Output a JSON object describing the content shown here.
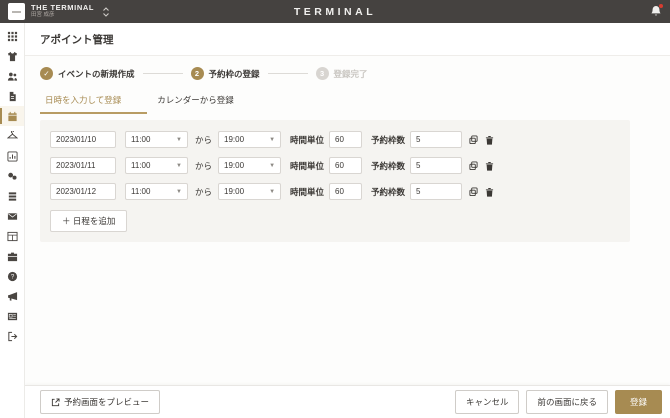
{
  "topbar": {
    "brand_title": "THE TERMINAL",
    "brand_subtitle": "田宮 成彦",
    "center_logo": "TERMINAL"
  },
  "page": {
    "title": "アポイント管理"
  },
  "stepper": {
    "steps": [
      {
        "num": "✓",
        "label": "イベントの新規作成",
        "state": "done"
      },
      {
        "num": "2",
        "label": "予約枠の登録",
        "state": "active"
      },
      {
        "num": "3",
        "label": "登録完了",
        "state": "inactive"
      }
    ]
  },
  "tabs": [
    {
      "label": "日時を入力して登録",
      "active": true
    },
    {
      "label": "カレンダーから登録",
      "active": false
    }
  ],
  "panel": {
    "rows": [
      {
        "date": "2023/01/10",
        "start": "11:00",
        "joiner": "から",
        "end": "19:00",
        "unit_label": "時間単位",
        "unit": "60",
        "slots_label": "予約枠数",
        "slots": "5"
      },
      {
        "date": "2023/01/11",
        "start": "11:00",
        "joiner": "から",
        "end": "19:00",
        "unit_label": "時間単位",
        "unit": "60",
        "slots_label": "予約枠数",
        "slots": "5"
      },
      {
        "date": "2023/01/12",
        "start": "11:00",
        "joiner": "から",
        "end": "19:00",
        "unit_label": "時間単位",
        "unit": "60",
        "slots_label": "予約枠数",
        "slots": "5"
      }
    ],
    "add_button": "＋ 日程を追加"
  },
  "footer": {
    "preview": "予約画面をプレビュー",
    "cancel": "キャンセル",
    "back": "前の画面に戻る",
    "submit": "登録"
  },
  "sidebar": {
    "items": [
      "apps-grid-icon",
      "shirt-icon",
      "team-icon",
      "document-icon",
      "calendar-icon",
      "hanger-icon",
      "chart-icon",
      "tags-icon",
      "stack-icon",
      "mail-icon",
      "table-icon",
      "briefcase-icon",
      "help-icon",
      "megaphone-icon",
      "news-icon",
      "logout-icon"
    ],
    "active_index": 4
  },
  "colors": {
    "gold": "#a78b52",
    "topbar_bg": "#454240",
    "panel_bg": "#f5f4f1",
    "alert_red": "#d63c30"
  }
}
